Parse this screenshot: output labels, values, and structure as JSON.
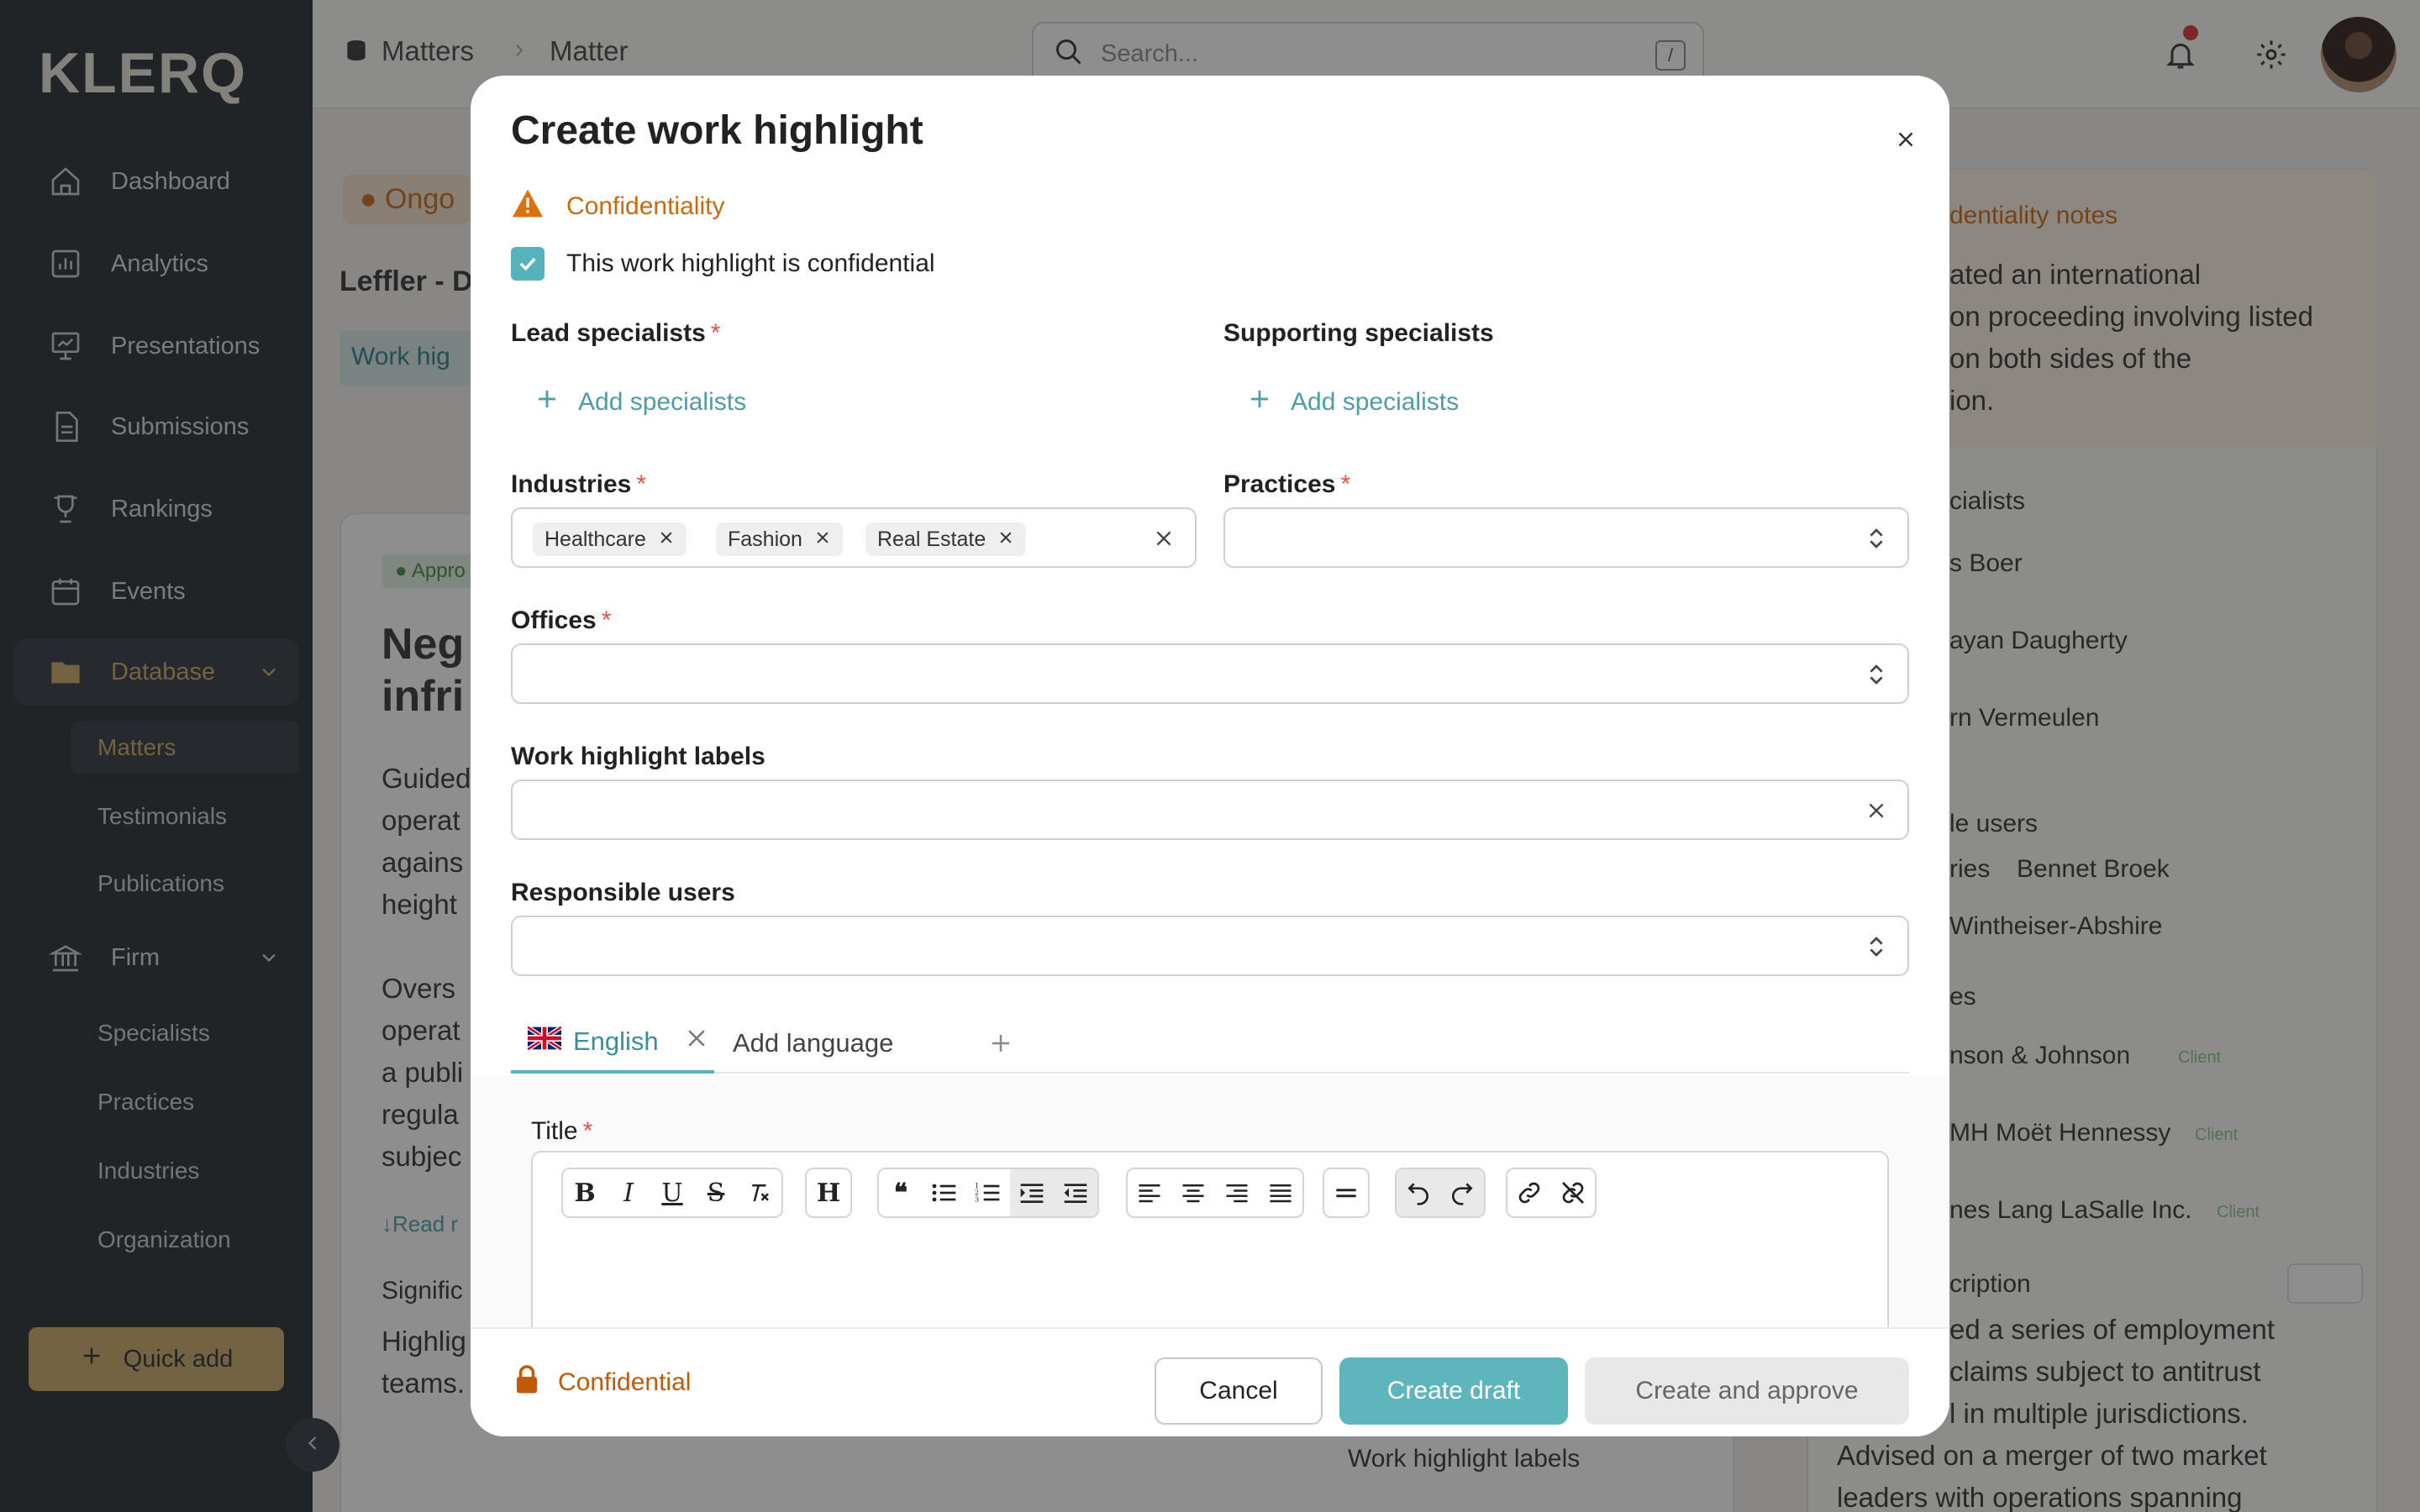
{
  "app": {
    "logo": "KLERQ"
  },
  "sidebar": {
    "items": [
      {
        "label": "Dashboard",
        "icon": "home-icon"
      },
      {
        "label": "Analytics",
        "icon": "chart-icon"
      },
      {
        "label": "Presentations",
        "icon": "presentation-icon"
      },
      {
        "label": "Submissions",
        "icon": "document-icon"
      },
      {
        "label": "Rankings",
        "icon": "trophy-icon"
      },
      {
        "label": "Events",
        "icon": "calendar-icon"
      },
      {
        "label": "Database",
        "icon": "folder-icon"
      },
      {
        "label": "Firm",
        "icon": "bank-icon"
      }
    ],
    "database_sub": [
      "Matters",
      "Testimonials",
      "Publications"
    ],
    "firm_sub": [
      "Specialists",
      "Practices",
      "Industries",
      "Organization"
    ],
    "quick_add": "Quick add"
  },
  "topbar": {
    "breadcrumb_1": "Matters",
    "breadcrumb_2": "Matter",
    "search_placeholder": "Search...",
    "search_shortcut": "/"
  },
  "background": {
    "status": "Ongo",
    "matter_title": "Leffler - D",
    "tab": "Work hig",
    "approved_badge": "Appro",
    "heading_1": "Neg",
    "heading_2": "infri",
    "para1": [
      "Guided",
      "operat",
      "agains",
      "height"
    ],
    "para2": [
      "Overs",
      "operat",
      "a publi",
      "regula",
      "subjec"
    ],
    "read_more": "Read r",
    "signif": "Signific",
    "signif_text": [
      "Highlig",
      "teams."
    ],
    "wh_labels": "Work highlight labels",
    "right_panel": {
      "conf_notes": "dentiality notes",
      "notes_lines": [
        "ated an international",
        "on proceeding involving listed",
        "on both sides of the",
        "ion."
      ],
      "specialists_head": "cialists",
      "specialists": [
        "s Boer",
        "ayan Daugherty",
        "rn Vermeulen"
      ],
      "resp_head": "le users",
      "resp_users": [
        "ries",
        "Bennet Broek",
        "Wintheiser-Abshire"
      ],
      "clients_head": "es",
      "clients": [
        "nson & Johnson",
        "MH Moët Hennessy",
        "nes Lang LaSalle Inc."
      ],
      "client_tag": "Client",
      "desc_head": "cription",
      "desc_lines": [
        "ed a series of employment",
        "claims subject to antitrust",
        "l in multiple jurisdictions.",
        "Advised on a merger of two market",
        "leaders with operations spanning"
      ]
    }
  },
  "modal": {
    "title": "Create work highlight",
    "confidentiality_label": "Confidentiality",
    "confidential_checkbox": "This work highlight is confidential",
    "lead_specialists": "Lead specialists",
    "supporting_specialists": "Supporting specialists",
    "add_specialists": "Add specialists",
    "industries": "Industries",
    "industry_chips": [
      "Healthcare",
      "Fashion",
      "Real Estate"
    ],
    "practices": "Practices",
    "offices": "Offices",
    "labels": "Work highlight labels",
    "responsible_users": "Responsible users",
    "lang_english": "English",
    "add_language": "Add language",
    "title_field": "Title",
    "required_mark": "*",
    "footer_confidential": "Confidential",
    "cancel": "Cancel",
    "create_draft": "Create draft",
    "create_approve": "Create and approve"
  },
  "colors": {
    "accent": "#57b3bb",
    "gold": "#c9a868",
    "warning": "#c96a10",
    "sidebar": "#252a30"
  }
}
